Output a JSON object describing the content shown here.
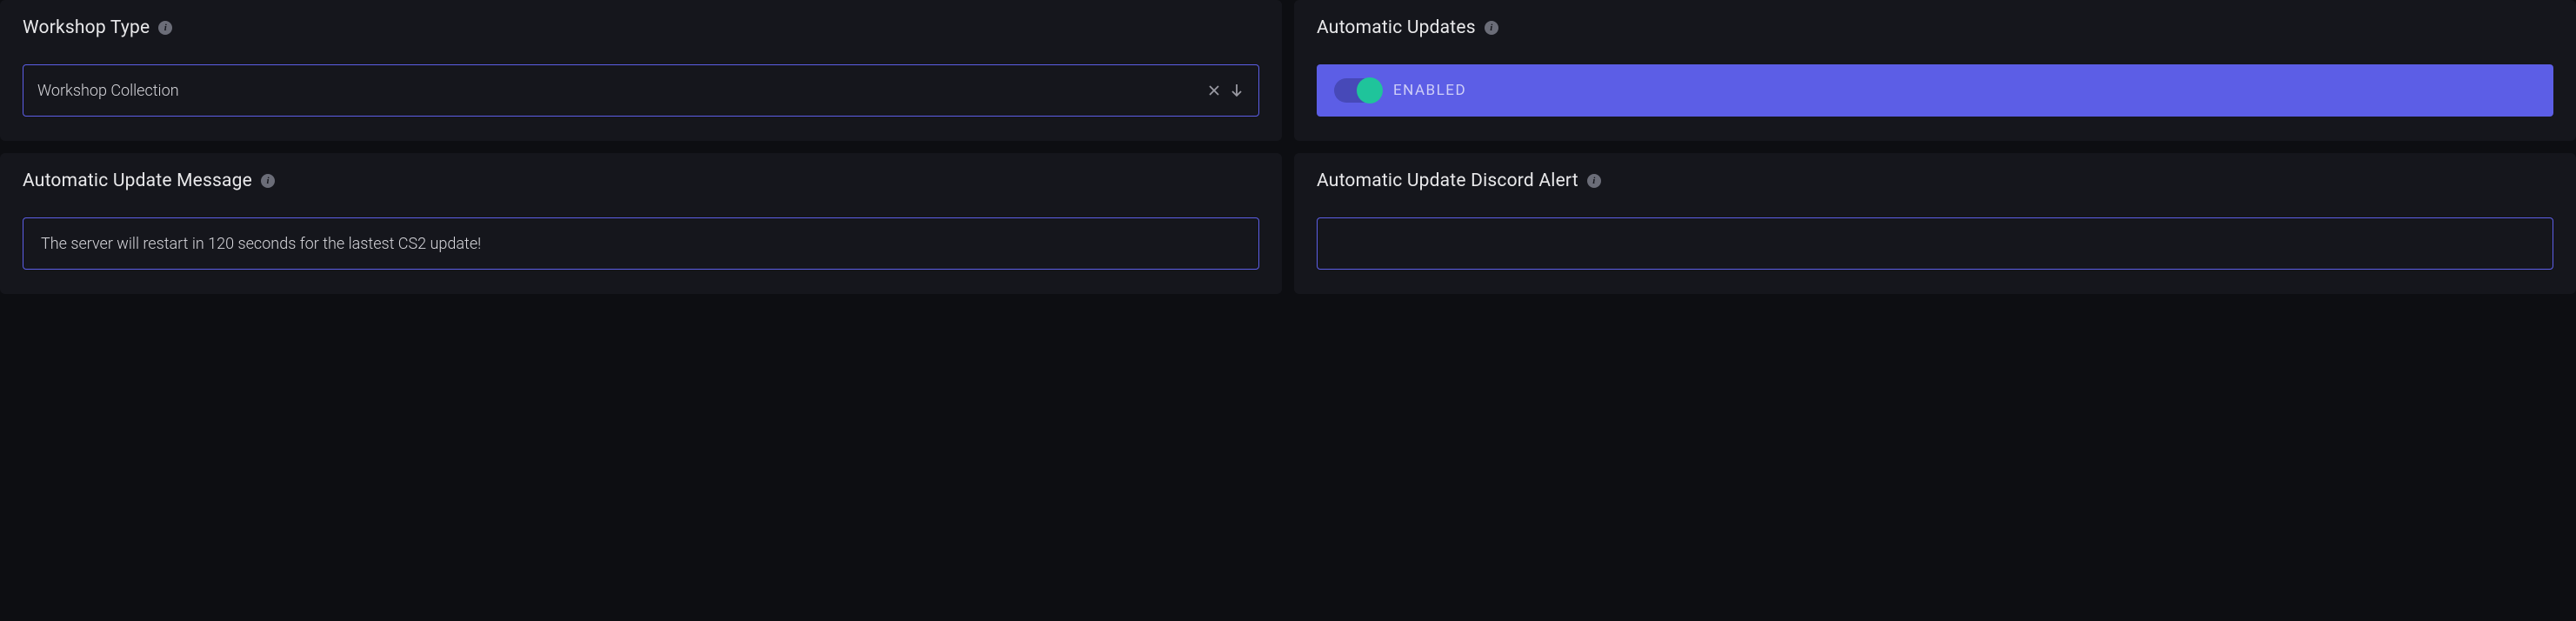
{
  "cards": {
    "workshop_type": {
      "title": "Workshop Type",
      "select": {
        "value": "Workshop Collection"
      }
    },
    "automatic_updates": {
      "title": "Automatic Updates",
      "toggle": {
        "on": true,
        "label": "ENABLED"
      }
    },
    "automatic_update_message": {
      "title": "Automatic Update Message",
      "input": {
        "value": "The server will restart in 120 seconds for the lastest CS2 update!"
      }
    },
    "automatic_update_discord_alert": {
      "title": "Automatic Update Discord Alert",
      "input": {
        "value": ""
      }
    }
  }
}
